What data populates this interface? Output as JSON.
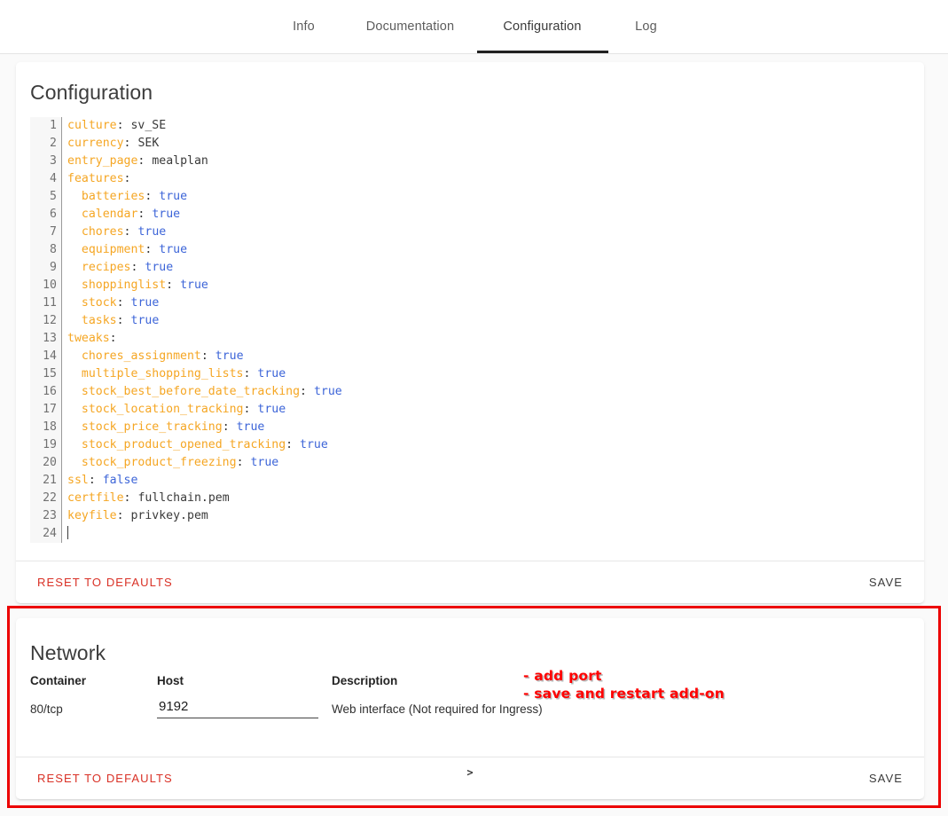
{
  "tabs": [
    {
      "label": "Info",
      "active": false
    },
    {
      "label": "Documentation",
      "active": false
    },
    {
      "label": "Configuration",
      "active": true
    },
    {
      "label": "Log",
      "active": false
    }
  ],
  "config_card": {
    "title": "Configuration",
    "line_count": 24,
    "lines": [
      {
        "n": 1,
        "key": "culture",
        "indent": 0,
        "value": "sv_SE",
        "value_type": "scalar"
      },
      {
        "n": 2,
        "key": "currency",
        "indent": 0,
        "value": "SEK",
        "value_type": "scalar"
      },
      {
        "n": 3,
        "key": "entry_page",
        "indent": 0,
        "value": "mealplan",
        "value_type": "scalar"
      },
      {
        "n": 4,
        "key": "features",
        "indent": 0,
        "value": "",
        "value_type": "mapping"
      },
      {
        "n": 5,
        "key": "batteries",
        "indent": 1,
        "value": "true",
        "value_type": "bool"
      },
      {
        "n": 6,
        "key": "calendar",
        "indent": 1,
        "value": "true",
        "value_type": "bool"
      },
      {
        "n": 7,
        "key": "chores",
        "indent": 1,
        "value": "true",
        "value_type": "bool"
      },
      {
        "n": 8,
        "key": "equipment",
        "indent": 1,
        "value": "true",
        "value_type": "bool"
      },
      {
        "n": 9,
        "key": "recipes",
        "indent": 1,
        "value": "true",
        "value_type": "bool"
      },
      {
        "n": 10,
        "key": "shoppinglist",
        "indent": 1,
        "value": "true",
        "value_type": "bool"
      },
      {
        "n": 11,
        "key": "stock",
        "indent": 1,
        "value": "true",
        "value_type": "bool"
      },
      {
        "n": 12,
        "key": "tasks",
        "indent": 1,
        "value": "true",
        "value_type": "bool"
      },
      {
        "n": 13,
        "key": "tweaks",
        "indent": 0,
        "value": "",
        "value_type": "mapping"
      },
      {
        "n": 14,
        "key": "chores_assignment",
        "indent": 1,
        "value": "true",
        "value_type": "bool"
      },
      {
        "n": 15,
        "key": "multiple_shopping_lists",
        "indent": 1,
        "value": "true",
        "value_type": "bool"
      },
      {
        "n": 16,
        "key": "stock_best_before_date_tracking",
        "indent": 1,
        "value": "true",
        "value_type": "bool"
      },
      {
        "n": 17,
        "key": "stock_location_tracking",
        "indent": 1,
        "value": "true",
        "value_type": "bool"
      },
      {
        "n": 18,
        "key": "stock_price_tracking",
        "indent": 1,
        "value": "true",
        "value_type": "bool"
      },
      {
        "n": 19,
        "key": "stock_product_opened_tracking",
        "indent": 1,
        "value": "true",
        "value_type": "bool"
      },
      {
        "n": 20,
        "key": "stock_product_freezing",
        "indent": 1,
        "value": "true",
        "value_type": "bool"
      },
      {
        "n": 21,
        "key": "ssl",
        "indent": 0,
        "value": "false",
        "value_type": "bool"
      },
      {
        "n": 22,
        "key": "certfile",
        "indent": 0,
        "value": "fullchain.pem",
        "value_type": "scalar"
      },
      {
        "n": 23,
        "key": "keyfile",
        "indent": 0,
        "value": "privkey.pem",
        "value_type": "scalar"
      },
      {
        "n": 24,
        "key": "",
        "indent": 0,
        "value": "",
        "value_type": "empty"
      }
    ],
    "footer": {
      "reset_label": "RESET TO DEFAULTS",
      "save_label": "SAVE"
    }
  },
  "network_card": {
    "title": "Network",
    "columns": [
      "Container",
      "Host",
      "Description"
    ],
    "rows": [
      {
        "container": "80/tcp",
        "host": "9192",
        "host_placeholder": "",
        "description": "Web interface (Not required for Ingress)"
      }
    ],
    "footer": {
      "reset_label": "RESET TO DEFAULTS",
      "save_label": "SAVE",
      "caret": ">"
    }
  },
  "annotation": {
    "text": "- add port\n- save and restart add-on",
    "color": "#ff0000"
  },
  "highlight_box": {
    "color": "#ec0000"
  },
  "theme": {
    "page_background": "#fafafa",
    "card_background": "#ffffff",
    "active_tab_indicator": "#212121",
    "yaml_key": "#f5a623",
    "yaml_bool": "#3d65d8",
    "yaml_scalar": "#3a3a3a",
    "danger": "#d93025"
  }
}
